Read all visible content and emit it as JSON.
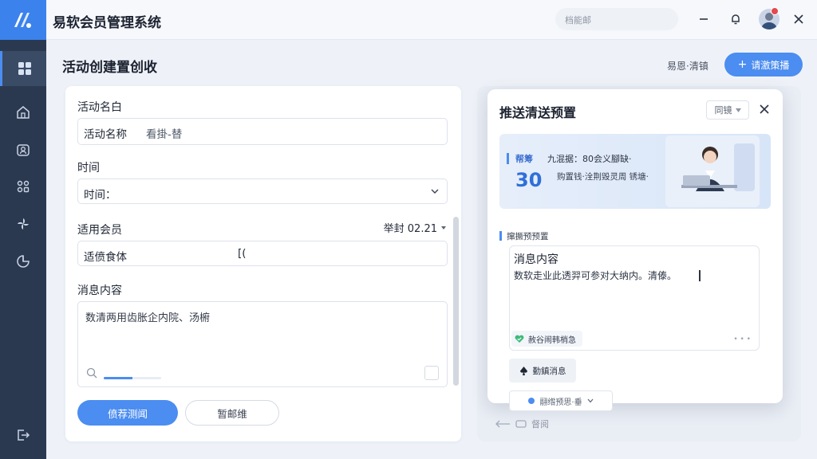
{
  "app": {
    "title": "易软会员管理系统"
  },
  "header": {
    "search_text": "档能邮"
  },
  "page": {
    "title": "活动创建置创收",
    "link_label": "易恩·清镇",
    "primary_btn": "请激策播"
  },
  "form": {
    "name_label": "活动名白",
    "name_value": "活动名称",
    "name_hint": "看掛-替",
    "time_label": "时间",
    "time_value": "时间：",
    "member_label": "适用会员",
    "member_date": "举封 02.21",
    "member_value": "适偾食体",
    "member_extra": "[(",
    "content_label": "消息内容",
    "content_value": "数清两用齿胀企内院、汤椨",
    "content_progress": 0.5,
    "submit_label": "偾荐测闻",
    "cancel_label": "暂邮维"
  },
  "preview": {
    "title": "推送清送预置",
    "select_label": "同镜",
    "banner_tag": "帮筹",
    "banner_line1": "九混据：80会义腳缺·",
    "banner_num": "30",
    "banner_line2": "购置钱·洤荆毁灵周 锈塘·",
    "section_label": "撺撅预预置",
    "msg_title": "消息内容",
    "msg_body": "数软走业此透羿可参对大纳内。清傣。",
    "msg_chip": "赦谷闹韩梢急",
    "action_chip": "勤鎮消息",
    "select_chip": "翮绺预思·垂",
    "footer_label": "督阅"
  },
  "colors": {
    "brand": "#3c82ec",
    "sidebar": "#2b3950",
    "accent": "#4b8df0"
  }
}
